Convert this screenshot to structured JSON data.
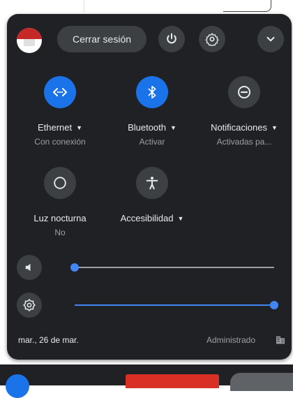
{
  "window": {
    "background_accent": "#1a73e8"
  },
  "header": {
    "signout_label": "Cerrar sesión",
    "avatar_icon": "avatar-icon",
    "power_icon": "power-icon",
    "settings_icon": "gear-icon",
    "collapse_icon": "chevron-down-icon"
  },
  "features": [
    {
      "label": "Ethernet",
      "status": "Con conexión",
      "icon": "ethernet-icon",
      "active": true,
      "has_dropdown": true
    },
    {
      "label": "Bluetooth",
      "status": "Activar",
      "icon": "bluetooth-icon",
      "active": true,
      "has_dropdown": true
    },
    {
      "label": "Notificaciones",
      "status": "Activadas pa...",
      "icon": "do-not-disturb-icon",
      "active": false,
      "has_dropdown": true
    },
    {
      "label": "Luz nocturna",
      "status": "No",
      "icon": "night-light-icon",
      "active": false,
      "has_dropdown": false
    },
    {
      "label": "Accesibilidad",
      "status": "",
      "icon": "accessibility-icon",
      "active": false,
      "has_dropdown": true
    }
  ],
  "sliders": {
    "volume": {
      "icon": "volume-icon",
      "level": 0.0
    },
    "brightness": {
      "icon": "brightness-icon",
      "level": 1.0
    }
  },
  "footer": {
    "date": "mar., 26 de mar.",
    "managed_label": "Administrado",
    "managed_icon": "enterprise-icon"
  }
}
